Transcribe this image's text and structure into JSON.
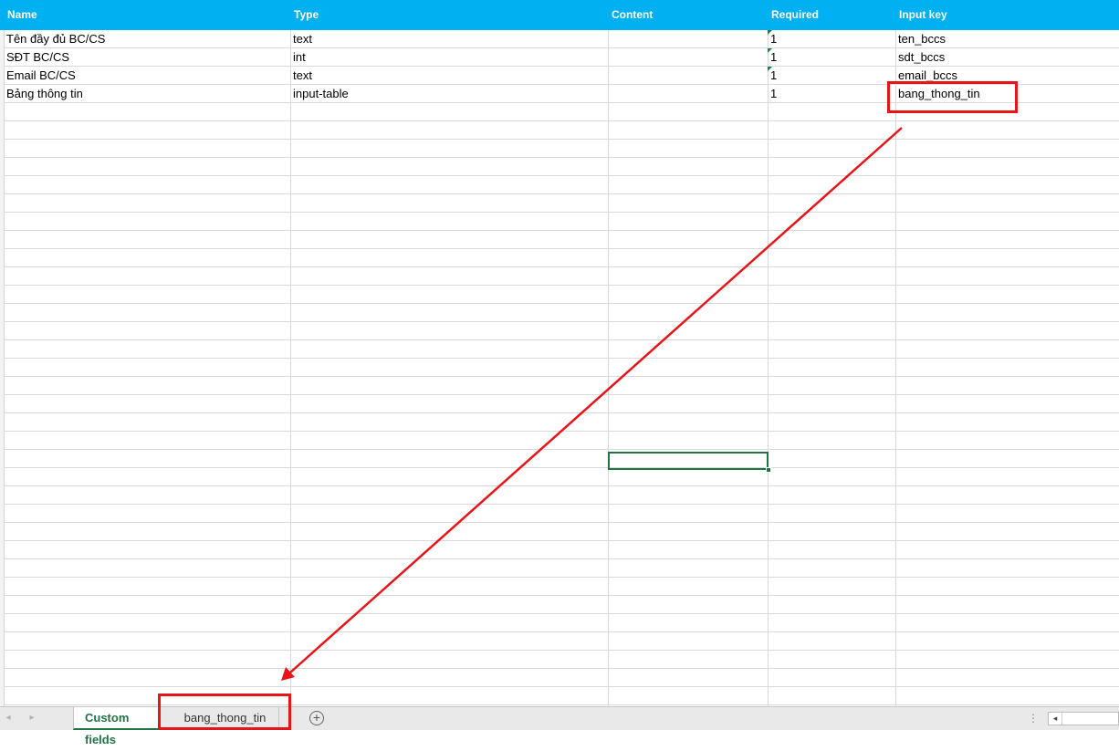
{
  "sheet": {
    "columns": [
      "Name",
      "Type",
      "Content",
      "Required",
      "Input key"
    ],
    "rows": [
      {
        "name": "Tên đầy đủ BC/CS",
        "type": "text",
        "content": "",
        "required": "1",
        "input_key": "ten_bccs"
      },
      {
        "name": "SĐT BC/CS",
        "type": "int",
        "content": "",
        "required": "1",
        "input_key": "sdt_bccs"
      },
      {
        "name": "Email BC/CS",
        "type": "text",
        "content": "",
        "required": "1",
        "input_key": "email_bccs"
      },
      {
        "name": "Bảng thông tin",
        "type": "input-table",
        "content": "",
        "required": "1",
        "input_key": "bang_thong_tin"
      }
    ]
  },
  "tabs": {
    "active": "Custom fields",
    "second": "bang_thong_tin",
    "add_label": "+"
  },
  "colors": {
    "header_bg": "#00b0f0",
    "accent": "#217346",
    "annotation": "#e8141a"
  },
  "icons": {
    "nav_prev": "◂",
    "nav_next": "▸",
    "more": "⋮",
    "scroll_left": "◂"
  }
}
